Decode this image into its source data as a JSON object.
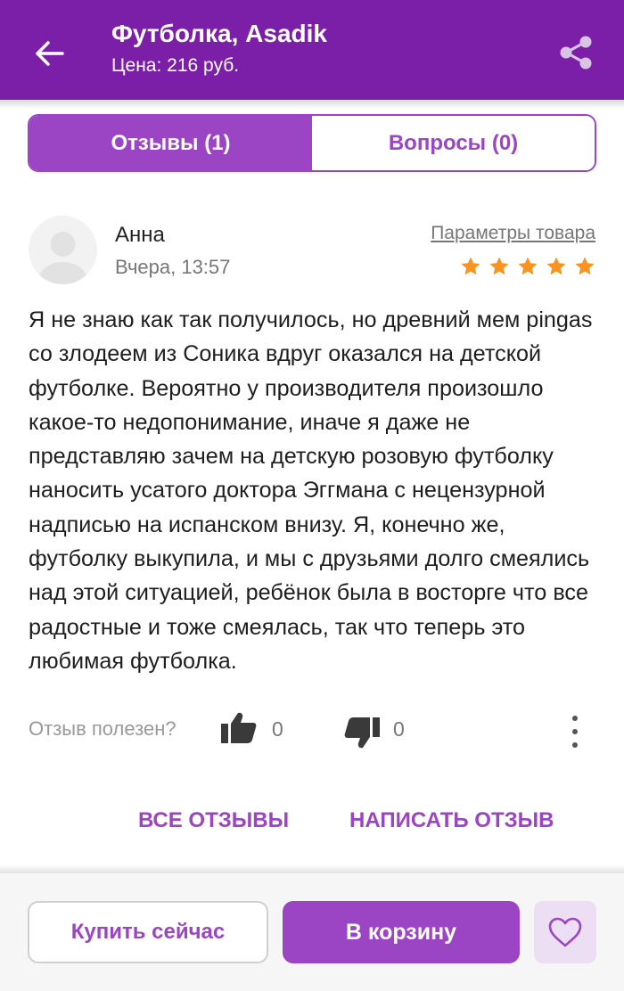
{
  "header": {
    "title": "Футболка, Asadik",
    "price": "Цена: 216 руб.",
    "back_icon": "arrow-left-icon",
    "share_icon": "share-icon",
    "color": "#7c1fa8"
  },
  "tabs": [
    {
      "label": "Отзывы (1)",
      "active": true
    },
    {
      "label": "Вопросы (0)",
      "active": false
    }
  ],
  "review": {
    "author": "Анна",
    "date": "Вчера, 13:57",
    "params_link": "Параметры товара",
    "rating": 5,
    "max_rating": 5,
    "text": "Я не знаю как так получилось, но древний мем pingas со злодеем из Соника вдруг оказался на детской футболке. Вероятно у производителя произошло какое-то недопонимание, иначе я даже не представляю зачем на детскую розовую футболку наносить усатого доктора Эггмана с нецензурной надписью на испанском внизу. Я, конечно же, футболку выкупила, и мы с друзьями долго смеялись над этой ситуацией, ребёнок была в восторге что все радостные и тоже смеялась, так что теперь это любимая футболка.",
    "helpful_label": "Отзыв полезен?",
    "likes": "0",
    "dislikes": "0"
  },
  "links": {
    "all_reviews": "ВСЕ ОТЗЫВЫ",
    "write_review": "НАПИСАТЬ ОТЗЫВ"
  },
  "bottom": {
    "buy_now": "Купить сейчас",
    "add_to_cart": "В корзину",
    "favorite_icon": "heart-icon"
  },
  "colors": {
    "accent": "#9b45c4",
    "star": "#f7931e"
  }
}
